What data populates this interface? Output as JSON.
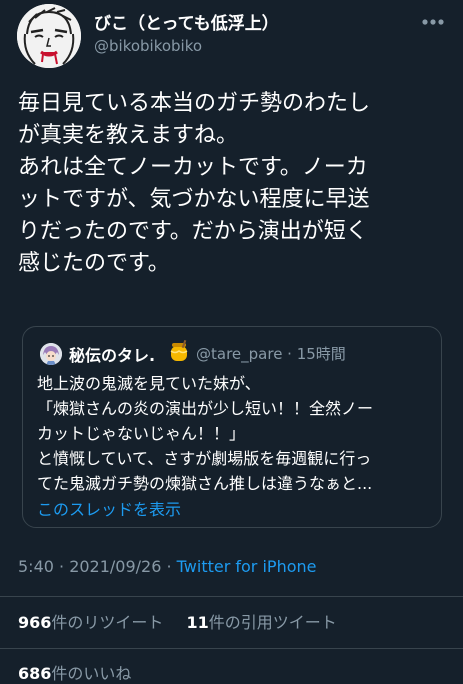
{
  "author": {
    "display_name": "びこ（とっても低浮上）",
    "handle": "@bikobikobiko",
    "avatar_icon": "sketch-face-avatar-icon"
  },
  "more_icon": "more-dots-icon",
  "tweet": {
    "lines": [
      "毎日見ている本当のガチ勢のわたし",
      "が真実を教えますね。",
      "あれは全てノーカットです。ノーカ",
      "ットですが、気づかない程度に早送",
      "りだったのです。だから演出が短く",
      "感じたのです。"
    ]
  },
  "quote": {
    "avatar_icon": "anime-character-avatar-icon",
    "name": "秘伝のタレ.",
    "emoji_icon": "honey-pot-emoji-icon",
    "meta": "@tare_pare · 15時間",
    "lines": [
      "地上波の鬼滅を見ていた妹が、",
      "「煉獄さんの炎の演出が少し短い！！全然ノー",
      "カットじゃないじゃん！！」",
      "と憤慨していて、さすが劇場版を毎週観に行っ",
      "てた鬼滅ガチ勢の煉獄さん推しは違うなぁと..."
    ],
    "thread_link": "このスレッドを表示"
  },
  "meta": {
    "timestamp": "5:40 · 2021/09/26 · ",
    "source": "Twitter for iPhone"
  },
  "stats": {
    "retweets_count": "966",
    "retweets_label": "件のリツイート",
    "quotes_count": "11",
    "quotes_label": "件の引用ツイート",
    "likes_count": "686",
    "likes_label": "件のいいね"
  },
  "colors": {
    "background": "#15202b",
    "text": "#ffffff",
    "secondary_text": "#8899a6",
    "link": "#1d9bf0",
    "border": "#38444d"
  }
}
